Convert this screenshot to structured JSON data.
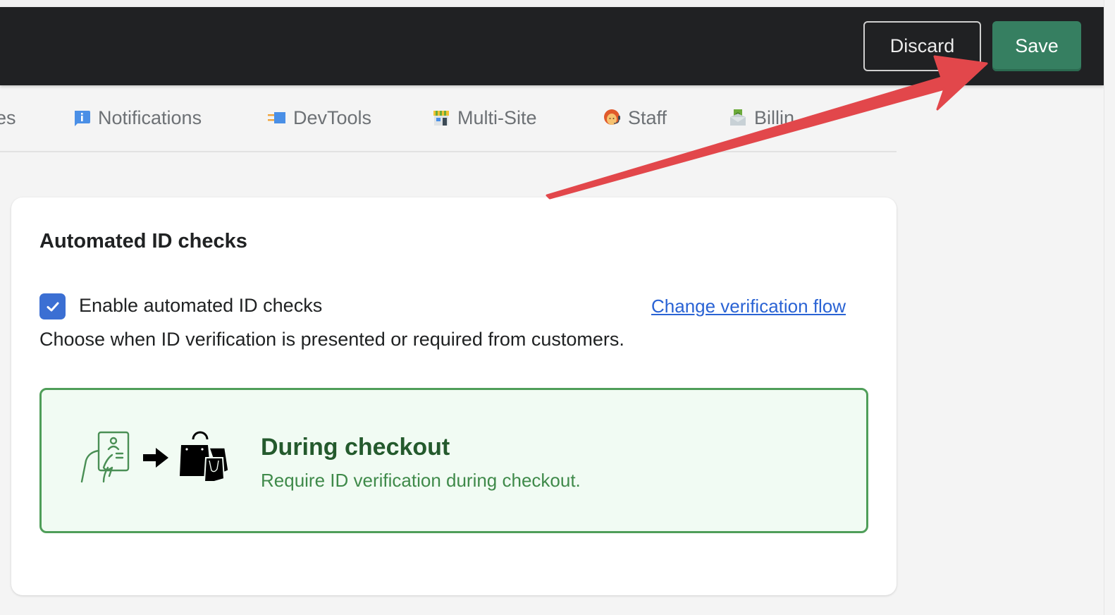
{
  "save_bar": {
    "discard_label": "Discard",
    "save_label": "Save"
  },
  "tabs": [
    {
      "label": "es",
      "icon": "truncated"
    },
    {
      "label": "Notifications",
      "icon": "info-bubble-icon"
    },
    {
      "label": "DevTools",
      "icon": "plug-icon"
    },
    {
      "label": "Multi-Site",
      "icon": "storefront-icon"
    },
    {
      "label": "Staff",
      "icon": "support-agent-icon"
    },
    {
      "label": "Billin",
      "icon": "money-envelope-icon"
    }
  ],
  "card": {
    "title": "Automated ID checks",
    "checkbox_label": "Enable automated ID checks",
    "checkbox_checked": true,
    "change_link": "Change verification flow",
    "help_text": "Choose when ID verification is presented or required from customers.",
    "option": {
      "title": "During checkout",
      "description": "Require ID verification during checkout.",
      "selected": true,
      "illustration": "id-card-to-shopping-bags"
    }
  },
  "colors": {
    "save_bar_bg": "#202123",
    "save_button": "#367f61",
    "checkbox": "#3b6fd3",
    "link": "#2a63d4",
    "option_border": "#4f9e59",
    "option_bg": "#f1fbf3",
    "option_title": "#245a2d",
    "annotation_arrow": "#e2474b"
  }
}
